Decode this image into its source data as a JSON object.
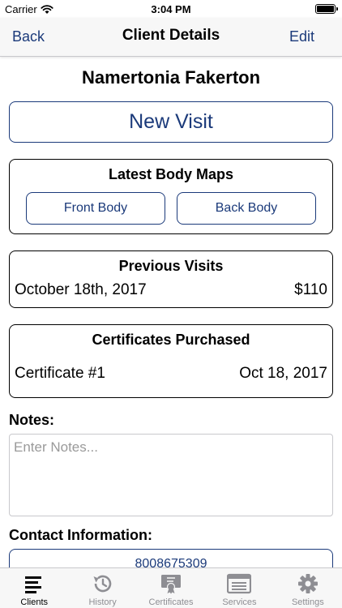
{
  "status_bar": {
    "carrier": "Carrier",
    "time": "3:04 PM"
  },
  "nav": {
    "back_label": "Back",
    "title": "Client Details",
    "edit_label": "Edit"
  },
  "client": {
    "name": "Namertonia Fakerton"
  },
  "new_visit": {
    "label": "New Visit"
  },
  "body_maps": {
    "title": "Latest Body Maps",
    "front_label": "Front Body",
    "back_label": "Back Body"
  },
  "previous_visits": {
    "title": "Previous Visits",
    "items": [
      {
        "date": "October 18th, 2017",
        "amount": "$110"
      }
    ]
  },
  "certificates": {
    "title": "Certificates Purchased",
    "items": [
      {
        "name": "Certificate #1",
        "date": "Oct 18, 2017"
      }
    ]
  },
  "notes": {
    "label": "Notes:",
    "placeholder": "Enter Notes...",
    "value": ""
  },
  "contact": {
    "label": "Contact Information:",
    "phone": "8008675309"
  },
  "tab_bar": {
    "tabs": [
      {
        "label": "Clients",
        "icon": "list-icon",
        "active": true
      },
      {
        "label": "History",
        "icon": "history-icon",
        "active": false
      },
      {
        "label": "Certificates",
        "icon": "certificate-icon",
        "active": false
      },
      {
        "label": "Services",
        "icon": "services-icon",
        "active": false
      },
      {
        "label": "Settings",
        "icon": "gear-icon",
        "active": false
      }
    ]
  },
  "colors": {
    "accent": "#1b3a7a",
    "tab_inactive": "#8e8e93",
    "tab_active": "#000000"
  }
}
